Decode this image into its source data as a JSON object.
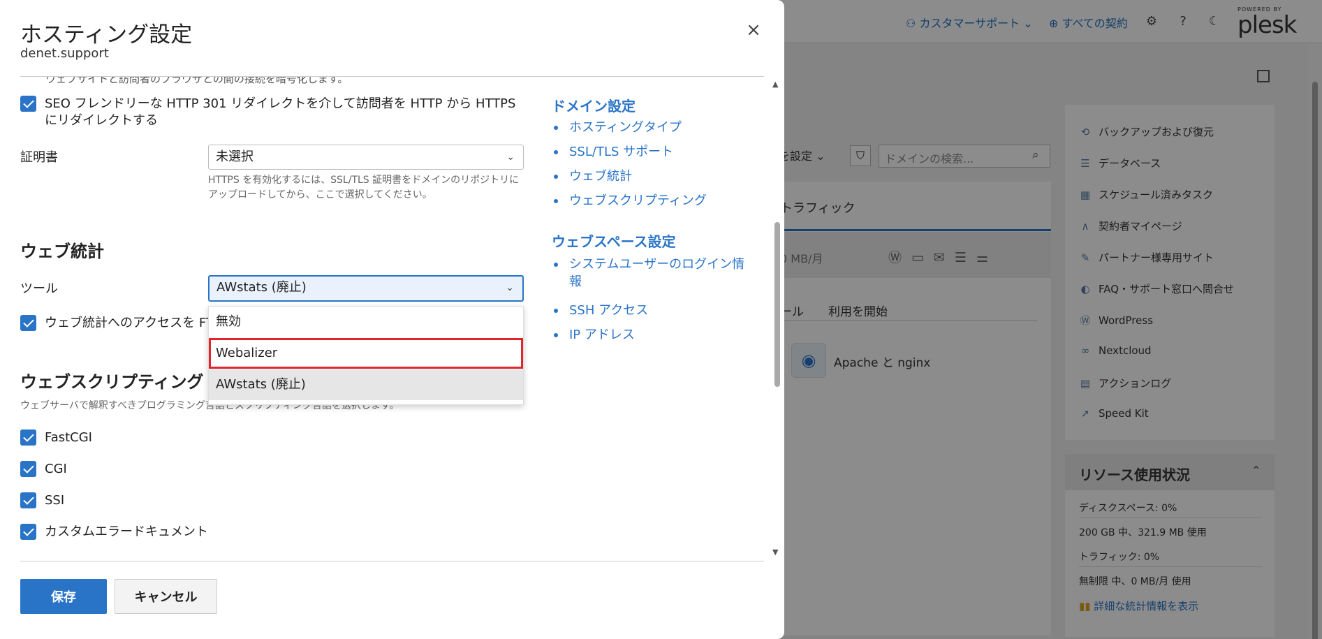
{
  "background": {
    "header": {
      "customer_support": "カスタマーサポート ⌄",
      "all_contracts": "すべての契約",
      "powered_by": "POWERED BY",
      "brand": "plesk"
    },
    "domains": {
      "filter_toggle": "を設定 ⌄",
      "search_placeholder": "ドメインの検索...",
      "tab_traffic": "トラフィック",
      "traffic_value": "0 MB/月",
      "col_tool": "ール",
      "col_start": "利用を開始",
      "server_name": "Apache と nginx"
    },
    "side_menu": [
      {
        "label": "バックアップおよび復元",
        "icon": "backup-icon"
      },
      {
        "label": "データベース",
        "icon": "database-icon"
      },
      {
        "label": "スケジュール済みタスク",
        "icon": "calendar-icon"
      },
      {
        "label": "契約者マイページ",
        "icon": "mypage-icon"
      },
      {
        "label": "パートナー様専用サイト",
        "icon": "partner-icon"
      },
      {
        "label": "FAQ・サポート窓口へ問合せ",
        "icon": "faq-icon"
      },
      {
        "label": "WordPress",
        "icon": "wordpress-icon"
      },
      {
        "label": "Nextcloud",
        "icon": "nextcloud-icon"
      },
      {
        "label": "アクションログ",
        "icon": "action-log-icon"
      },
      {
        "label": "Speed Kit",
        "icon": "speedkit-icon"
      }
    ],
    "resources": {
      "title": "リソース使用状況",
      "disk_label": "ディスクスペース: 0%",
      "disk_detail": "200 GB 中、321.9 MB 使用",
      "traffic_label": "トラフィック: 0%",
      "traffic_detail": "無制限 中、0 MB/月 使用",
      "stats_link": "詳細な統計情報を表示"
    }
  },
  "dialog": {
    "title": "ホスティング設定",
    "subtitle": "denet.support",
    "cut_text": "ウェブサイトと訪問者のブラウザとの間の接続を暗号化します。",
    "https_redirect": {
      "checked": true,
      "label": "SEO フレンドリーな HTTP 301 リダイレクトを介して訪問者を HTTP から HTTPS にリダイレクトする"
    },
    "certificate": {
      "label": "証明書",
      "value": "未選択",
      "hint": "HTTPS を有効化するには、SSL/TLS 証明書をドメインのリポジトリにアップロードしてから、ここで選択してください。"
    },
    "web_stats": {
      "title": "ウェブ統計",
      "tool_label": "ツール",
      "tool_value": "AWstats (廃止)",
      "ftp_access": {
        "checked": true,
        "label": "ウェブ統計へのアクセスを FTP"
      },
      "options": [
        "無効",
        "Webalizer",
        "AWstats (廃止)"
      ],
      "highlighted_option": "Webalizer",
      "selected_option": "AWstats (廃止)"
    },
    "web_scripting": {
      "title": "ウェブスクリプティング",
      "description": "ウェブサーバで解釈すべきプログラミング言語とスクリプティング言語を選択します。",
      "options": [
        {
          "label": "FastCGI",
          "checked": true
        },
        {
          "label": "CGI",
          "checked": true
        },
        {
          "label": "SSI",
          "checked": true
        },
        {
          "label": "カスタムエラードキュメント",
          "checked": true
        }
      ]
    },
    "nav": {
      "domain_settings": {
        "heading": "ドメイン設定",
        "links": [
          "ホスティングタイプ",
          "SSL/TLS サポート",
          "ウェブ統計",
          "ウェブスクリプティング"
        ]
      },
      "webspace_settings": {
        "heading": "ウェブスペース設定",
        "links": [
          "システムユーザーのログイン情報",
          "SSH アクセス",
          "IP アドレス"
        ]
      }
    },
    "buttons": {
      "save": "保存",
      "cancel": "キャンセル"
    },
    "close_symbol": "×"
  }
}
